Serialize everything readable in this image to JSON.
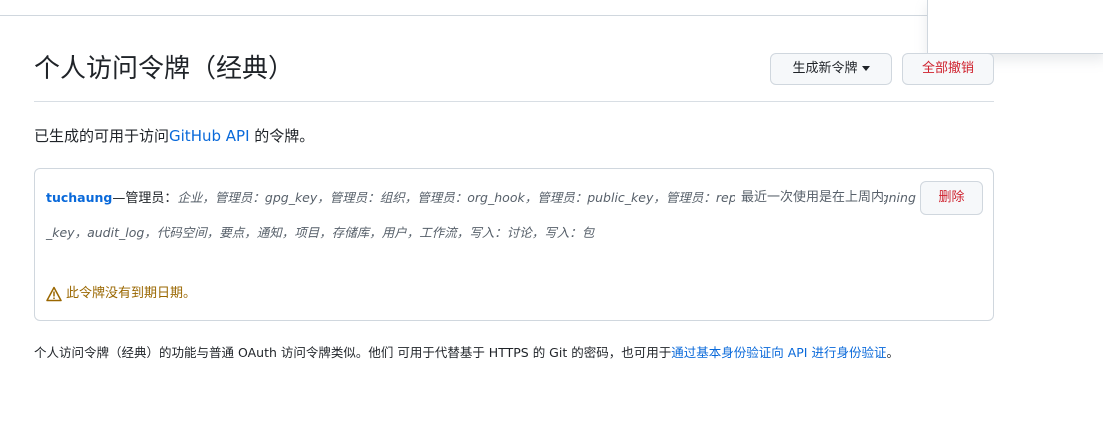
{
  "header": {
    "title": "个人访问令牌（经典）",
    "generate_label": "生成新令牌",
    "revoke_all_label": "全部撤销"
  },
  "intro": {
    "text": "已生成的可用于访问",
    "link": "GitHub API",
    "suffix": " 的令牌。"
  },
  "token": {
    "name": "tuchaung",
    "name_sep": "—",
    "purpose": "管理员：",
    "scopes": "企业，管理员：gpg_key，管理员：组织，管理员：org_hook，管理员：public_key，管理员：repo_hook，管理员：ssh_signing_key，audit_log，代码空间，要点，通知，项目，存储库，用户，工作流，写入：讨论，写入：包",
    "last_used": "最近一次使用是在上周内",
    "delete_label": "删除",
    "expiry_warning": "此令牌没有到期日期。"
  },
  "footer": {
    "text": "个人访问令牌（经典）的功能与普通 OAuth 访问令牌类似。他们 可用于代替基于 HTTPS 的 Git 的密码，也可用于",
    "link": "通过基本身份验证向 API 进行身份验证",
    "suffix": "。"
  },
  "colors": {
    "link": "#0969da",
    "danger": "#cf222e",
    "warning": "#9a6700",
    "border": "#d0d7de"
  },
  "icons": {
    "expiry": "alert-triangle-icon",
    "dropdown": "caret-down-icon"
  }
}
